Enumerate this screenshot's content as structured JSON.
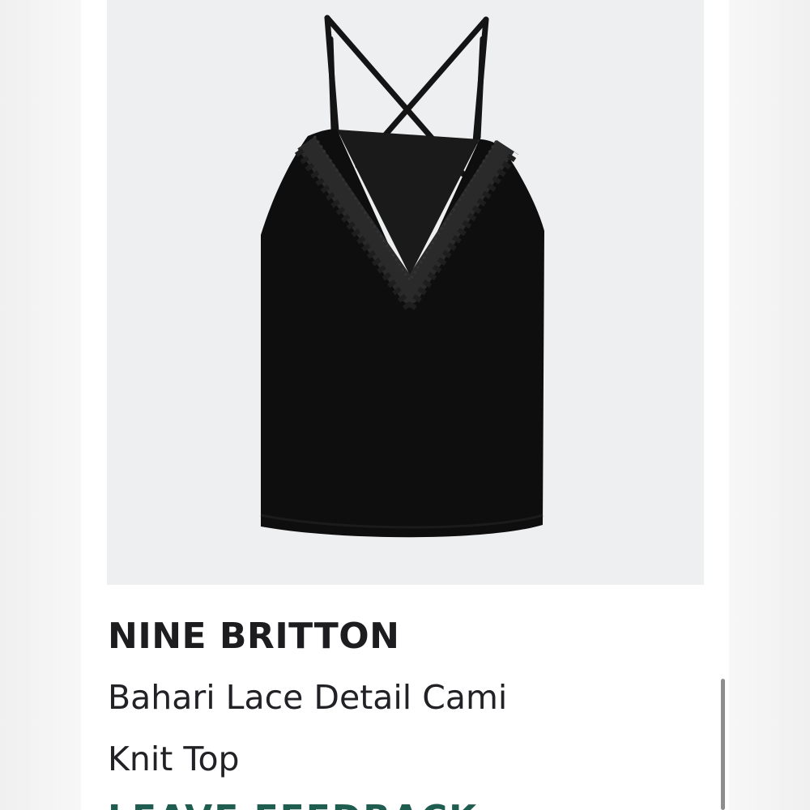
{
  "product": {
    "brand": "NINE BRITTON",
    "name_line1": "Bahari Lace Detail Cami",
    "name_line2": "Knit Top",
    "image_icon": "black-cami-top-image"
  },
  "actions": {
    "feedback_label": "LEAVE FEEDBACK",
    "feedback_arrow": "→"
  },
  "colors": {
    "image_background": "#eeeff1",
    "garment": "#0e0e0e",
    "feedback_accent": "#1f5d51",
    "brand_text": "#1d1d1f"
  }
}
